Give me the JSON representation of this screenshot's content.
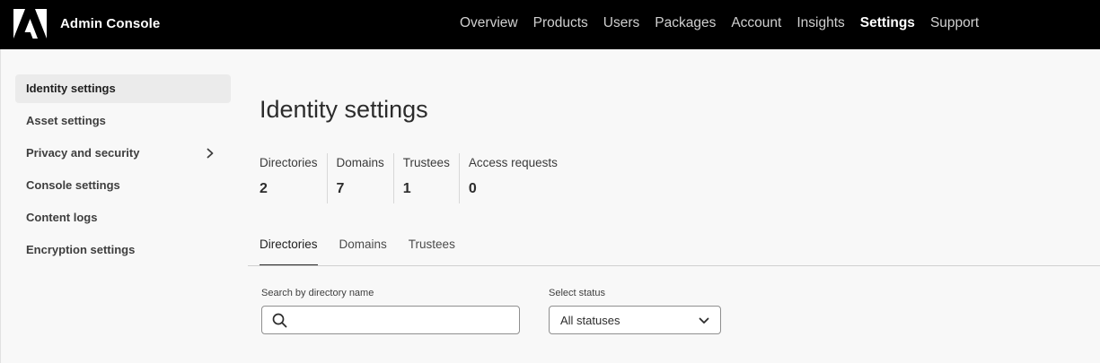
{
  "header": {
    "app_title": "Admin Console",
    "logo_icon": "adobe-logo-icon",
    "nav": [
      {
        "label": "Overview"
      },
      {
        "label": "Products"
      },
      {
        "label": "Users"
      },
      {
        "label": "Packages"
      },
      {
        "label": "Account"
      },
      {
        "label": "Insights"
      },
      {
        "label": "Settings"
      },
      {
        "label": "Support"
      }
    ],
    "active_nav": "Settings"
  },
  "sidebar": {
    "items": [
      {
        "label": "Identity settings"
      },
      {
        "label": "Asset settings"
      },
      {
        "label": "Privacy and security"
      },
      {
        "label": "Console settings"
      },
      {
        "label": "Content logs"
      },
      {
        "label": "Encryption settings"
      }
    ],
    "active": "Identity settings"
  },
  "main": {
    "title": "Identity settings",
    "stats": [
      {
        "label": "Directories",
        "value": "2"
      },
      {
        "label": "Domains",
        "value": "7"
      },
      {
        "label": "Trustees",
        "value": "1"
      },
      {
        "label": "Access requests",
        "value": "0"
      }
    ],
    "tabs": [
      {
        "label": "Directories"
      },
      {
        "label": "Domains"
      },
      {
        "label": "Trustees"
      }
    ],
    "active_tab": "Directories",
    "search": {
      "label": "Search by directory name",
      "value": "",
      "placeholder": ""
    },
    "status_filter": {
      "label": "Select status",
      "value": "All statuses"
    }
  },
  "colors": {
    "header_bg": "#000000",
    "page_bg": "#f8f8f8",
    "active_sidebar_bg": "#ebebeb"
  }
}
